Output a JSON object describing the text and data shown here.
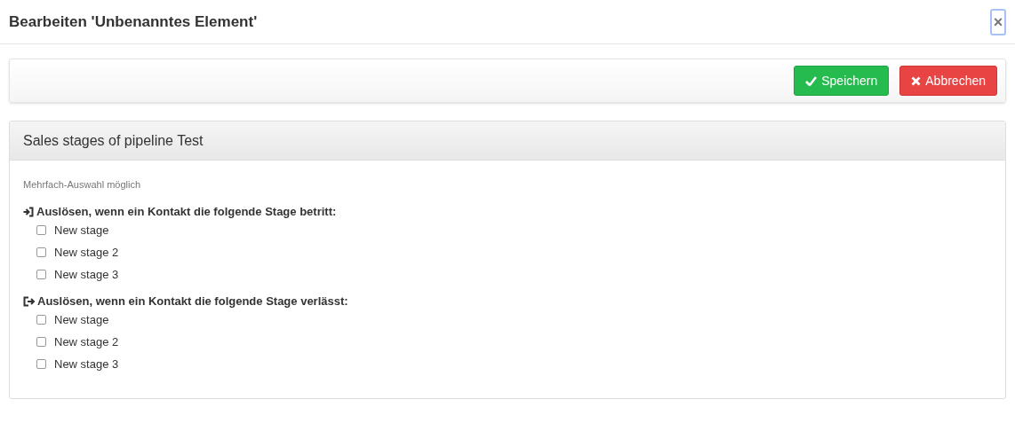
{
  "dialog": {
    "title": "Bearbeiten 'Unbenanntes Element'",
    "close": "×"
  },
  "toolbar": {
    "buttons": [
      {
        "kind": "save",
        "label": "Speichern"
      },
      {
        "kind": "cancel",
        "label": "Abbrechen"
      }
    ]
  },
  "panel": {
    "title": "Sales stages of pipeline Test",
    "hint": "Mehrfach-Auswahl möglich",
    "groups": [
      {
        "kind": "enter",
        "heading": "Auslösen, wenn ein Kontakt die folgende Stage betritt:",
        "options": [
          {
            "label": "New stage",
            "checked": false
          },
          {
            "label": "New stage 2",
            "checked": false
          },
          {
            "label": "New stage 3",
            "checked": false
          }
        ]
      },
      {
        "kind": "leave",
        "heading": "Auslösen, wenn ein Kontakt die folgende Stage verlässt:",
        "options": [
          {
            "label": "New stage",
            "checked": false
          },
          {
            "label": "New stage 2",
            "checked": false
          },
          {
            "label": "New stage 3",
            "checked": false
          }
        ]
      }
    ]
  }
}
